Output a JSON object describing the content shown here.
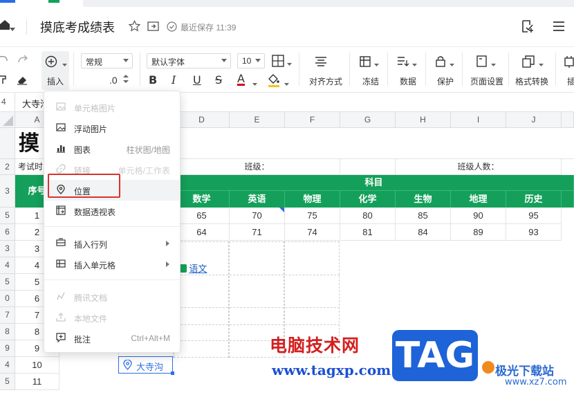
{
  "app": {
    "doc_title": "摸底考成绩表",
    "save_status": "最近保存 11:39"
  },
  "toolbar": {
    "insert_label": "插入",
    "number_format": "常规",
    "decimal_label": ".0",
    "font_name": "默认字体",
    "font_size": "10",
    "align_label": "对齐方式",
    "freeze_label": "冻结",
    "data_label": "数据",
    "protect_label": "保护",
    "page_setup_label": "页面设置",
    "format_convert_label": "格式转换",
    "accent_color": "#14a05a"
  },
  "formula_bar": {
    "row_label": "4",
    "cell_content": "大寺沟"
  },
  "sheet": {
    "columns": [
      "A",
      "D",
      "E",
      "F",
      "G",
      "H",
      "I",
      "J"
    ],
    "rows": [
      "1",
      "2",
      "3",
      "5",
      "6",
      "3",
      "4",
      "5",
      "9",
      "7",
      "8",
      "9",
      "4",
      "5"
    ],
    "row_labels": {
      "r1": "",
      "r2": "2",
      "r3": "3",
      "r4": "5",
      "r5": "6",
      "r6": "3",
      "r7": "4",
      "r8": "5",
      "r9": "0",
      "r10": "7",
      "r11": "8",
      "r12": "9",
      "r13": "4",
      "r14": "5"
    },
    "title_partial": "摸",
    "exam_time_partial": "考试时",
    "class_label": "班级：",
    "class_size_label": "班级人数：",
    "subjects_label": "科目",
    "seq_partial": "序号",
    "subject_headers": [
      "数学",
      "英语",
      "物理",
      "化学",
      "生物",
      "地理",
      "历史"
    ],
    "data_rows": [
      {
        "seq": "1",
        "scores": [
          "65",
          "70",
          "75",
          "80",
          "85",
          "90",
          "95"
        ]
      },
      {
        "seq": "2",
        "scores": [
          "64",
          "71",
          "74",
          "81",
          "84",
          "89",
          "93"
        ]
      }
    ],
    "seq_more": [
      "3",
      "4",
      "5",
      "6",
      "7",
      "8",
      "9",
      "10",
      "11"
    ],
    "link_text": "语文",
    "location_chip": "大寺沟"
  },
  "insert_menu": {
    "items": [
      {
        "label": "单元格图片",
        "hint": "",
        "disabled": true,
        "icon": "image-icon"
      },
      {
        "label": "浮动图片",
        "hint": "",
        "disabled": false,
        "icon": "image-icon"
      },
      {
        "label": "图表",
        "hint": "柱状图/地图",
        "disabled": false,
        "icon": "chart-icon"
      },
      {
        "label": "链接",
        "hint": "单元格/工作表",
        "disabled": true,
        "icon": "link-icon"
      },
      {
        "label": "位置",
        "hint": "",
        "disabled": false,
        "icon": "location-pin-icon"
      },
      {
        "label": "数据透视表",
        "hint": "",
        "disabled": false,
        "icon": "pivot-table-icon"
      },
      {
        "label": "插入行列",
        "hint": "",
        "disabled": false,
        "icon": "insert-rows-icon"
      },
      {
        "label": "插入单元格",
        "hint": "",
        "disabled": false,
        "icon": "insert-cells-icon"
      },
      {
        "label": "腾讯文档",
        "hint": "",
        "disabled": true,
        "icon": "cloud-doc-icon"
      },
      {
        "label": "本地文件",
        "hint": "",
        "disabled": true,
        "icon": "upload-icon"
      },
      {
        "label": "批注",
        "hint": "Ctrl+Alt+M",
        "disabled": false,
        "icon": "comment-icon"
      }
    ]
  },
  "watermark": {
    "brand_cn": "电脑技术网",
    "url": "www.tagxp.com",
    "tag": "TAG",
    "site_cn": "极光下载站",
    "site_url": "www.xz7.com"
  }
}
